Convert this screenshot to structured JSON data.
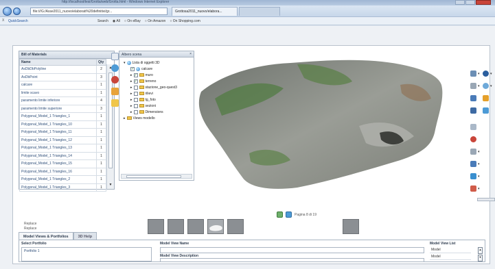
{
  "browser": {
    "window_title": "http://localhost/tesi/Grotta/web/Grotta.html - Windows Internet Explorer",
    "url": "file:///G:/Asse2011_nuovo/elaborati%20definitivi/gr...",
    "tabs": [
      {
        "label": "Grottosa2011_nuovo/elabora...",
        "active": true
      },
      {
        "label": "",
        "active": false
      }
    ],
    "toolbar": {
      "close_label": "X",
      "quicksearch_label": "QuickSearch",
      "search_label": "Search",
      "options": [
        "All",
        "On eBay",
        "On Amazon",
        "On Shopping.com"
      ]
    }
  },
  "bom": {
    "title": "Bill of Materials",
    "col_name": "Name",
    "col_qty": "Qty",
    "rows": [
      {
        "name": "AsDbDbPolyline",
        "qty": "2"
      },
      {
        "name": "AsDbPoint",
        "qty": "3"
      },
      {
        "name": "calcare",
        "qty": "1"
      },
      {
        "name": "limite scavo",
        "qty": "1"
      },
      {
        "name": "paramento limite inferiore",
        "qty": "4"
      },
      {
        "name": "paramento limite superiore",
        "qty": "3"
      },
      {
        "name": "Polygonal_Model_1 Triangles_1",
        "qty": "1"
      },
      {
        "name": "Polygonal_Model_1 Triangles_10",
        "qty": "1"
      },
      {
        "name": "Polygonal_Model_1 Triangles_11",
        "qty": "1"
      },
      {
        "name": "Polygonal_Model_1 Triangles_12",
        "qty": "1"
      },
      {
        "name": "Polygonal_Model_1 Triangles_13",
        "qty": "1"
      },
      {
        "name": "Polygonal_Model_1 Triangles_14",
        "qty": "1"
      },
      {
        "name": "Polygonal_Model_1 Triangles_15",
        "qty": "1"
      },
      {
        "name": "Polygonal_Model_1 Triangles_16",
        "qty": "1"
      },
      {
        "name": "Polygonal_Model_1 Triangles_2",
        "qty": "1"
      },
      {
        "name": "Polygonal_Model_1 Triangles_3",
        "qty": "1"
      }
    ]
  },
  "tree": {
    "title": "Albero scena",
    "close": "×",
    "root": "Lista di oggetti 3D",
    "items": [
      {
        "label": "calcare",
        "checked": true
      },
      {
        "label": "muro",
        "checked": true
      },
      {
        "label": "terreno",
        "checked": true
      },
      {
        "label": "stazione_geo-quest3",
        "checked": false
      },
      {
        "label": "rilievi",
        "checked": false
      },
      {
        "label": "tg_foto",
        "checked": false
      },
      {
        "label": "sezioni",
        "checked": false
      },
      {
        "label": "Dimensions",
        "checked": false
      }
    ],
    "views": "Views modello"
  },
  "pager": {
    "text": "Pagina 8 di 19"
  },
  "tagline": {
    "line1": "Replace",
    "line2": "Replace"
  },
  "bottom_tabs": [
    "Model Views & Portfolios",
    "3D Help"
  ],
  "portfolio": {
    "select_label": "Select Portfolio",
    "selected": "Portfolio 1",
    "view_name_label": "Model View Name",
    "view_desc_label": "Model View Description",
    "view_list_label": "Model View List",
    "view_list": [
      "Model",
      "Model",
      "Model"
    ]
  },
  "colors": {
    "accent": "#1c4f9a",
    "panel_header": "#cfd8e3",
    "rock": "#8a8f88"
  }
}
